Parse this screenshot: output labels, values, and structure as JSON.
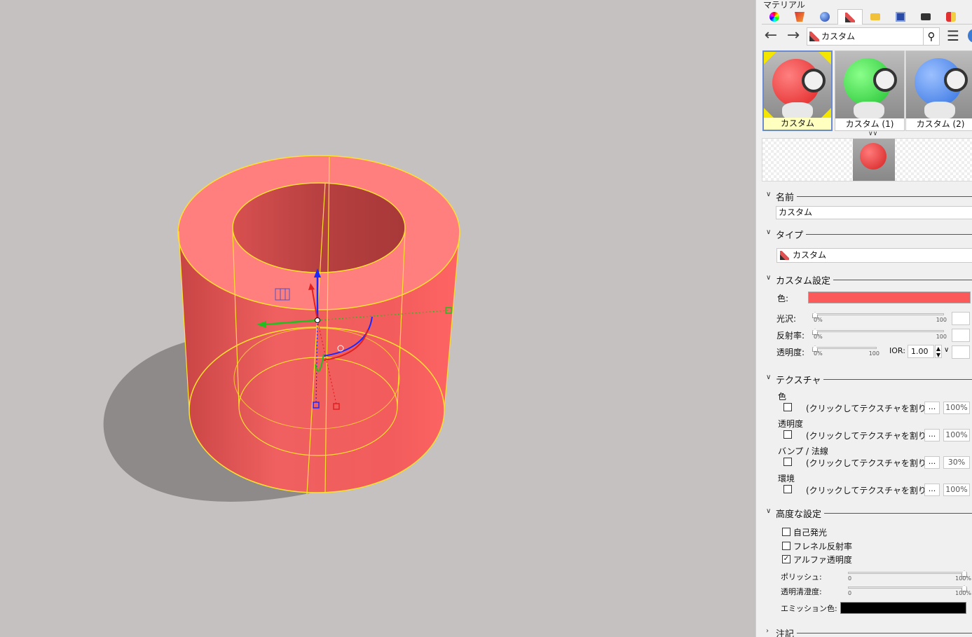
{
  "panel": {
    "title": "マテリアル",
    "tabs": [
      "color-wheel-icon",
      "render-icon",
      "sphere-icon",
      "material-brush-icon",
      "folder-icon",
      "screen-icon",
      "camera-icon",
      "light-icon"
    ],
    "active_tab": 3,
    "breadcrumb": "カスタム",
    "thumbnails": [
      {
        "label": "カスタム",
        "color": "#ff3b3b",
        "selected": true
      },
      {
        "label": "カスタム (1)",
        "color": "#33e84a",
        "selected": false
      },
      {
        "label": "カスタム (2)",
        "color": "#4c8ff5",
        "selected": false
      }
    ],
    "name_section": {
      "title": "名前",
      "value": "カスタム"
    },
    "type_section": {
      "title": "タイプ",
      "value": "カスタム"
    },
    "custom_section": {
      "title": "カスタム設定",
      "color_label": "色:",
      "color_value": "#fa5a5a",
      "gloss_label": "光沢:",
      "reflect_label": "反射率:",
      "transparency_label": "透明度:",
      "slider_min": "0%",
      "slider_max": "100",
      "ior_label": "IOR:",
      "ior_value": "1.00"
    },
    "texture_section": {
      "title": "テクスチャ",
      "rows": [
        {
          "label": "色",
          "placeholder": "(クリックしてテクスチャを割り...",
          "amount": "100%"
        },
        {
          "label": "透明度",
          "placeholder": "(クリックしてテクスチャを割り...",
          "amount": "100%"
        },
        {
          "label": "バンプ / 法線",
          "placeholder": "(クリックしてテクスチャを割り...",
          "amount": "30%"
        },
        {
          "label": "環境",
          "placeholder": "(クリックしてテクスチャを割り...",
          "amount": "100%"
        }
      ],
      "dots": "..."
    },
    "advanced_section": {
      "title": "高度な設定",
      "self_illum": "自己発光",
      "fresnel": "フレネル反射率",
      "alpha": "アルファ透明度",
      "alpha_checked": "✓",
      "polish_label": "ポリッシュ:",
      "clarity_label": "透明清澄度:",
      "adv_min": "0",
      "adv_max": "100%",
      "emission_label": "エミッション色:",
      "emission_color": "#000000"
    },
    "notes_section": {
      "title": "注記"
    }
  },
  "viewport": {
    "object_color": "#f25c5c",
    "edge_color": "#ffe030",
    "background": "#c6c1c1"
  }
}
